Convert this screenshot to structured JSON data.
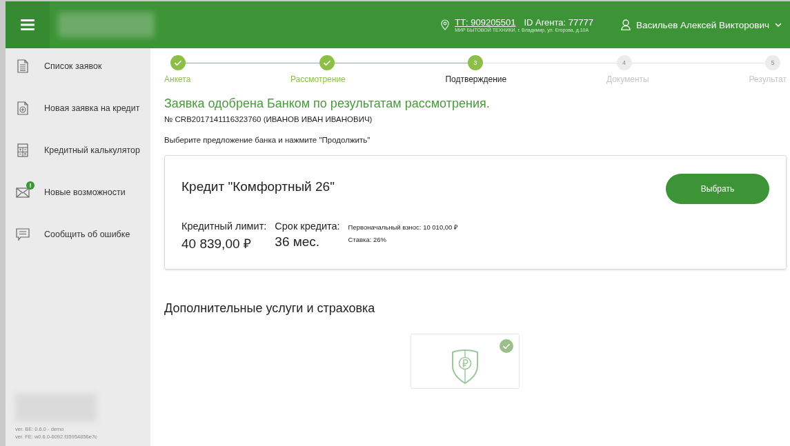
{
  "header": {
    "location_link": "ТТ: 909205501",
    "agent_id": "ID Агента: 77777",
    "address": "МИР БЫТОВОЙ ТЕХНИКИ, г. Владимир, ул. Егорова, д.10А",
    "user_name": "Васильев Алексей Викторович"
  },
  "sidebar": {
    "items": [
      {
        "kind": "list",
        "label": "Список заявок"
      },
      {
        "kind": "new",
        "label": "Новая заявка на кредит"
      },
      {
        "kind": "calculator",
        "label": "Кредитный калькулятор"
      },
      {
        "kind": "mail",
        "label": "Новые возможности",
        "badge": "!"
      },
      {
        "kind": "feedback",
        "label": "Сообщить об ошибке"
      }
    ],
    "versions": [
      "ver. BE: 0.6.0 - demo",
      "ver. FE: w0.6.0-6092.f35954856e7c"
    ]
  },
  "steps": [
    {
      "label": "Анкета",
      "done": true,
      "selected": false
    },
    {
      "label": "Рассмотрение",
      "done": true,
      "selected": false
    },
    {
      "label": "Подтверждение",
      "done": false,
      "selected": true,
      "number": "3"
    },
    {
      "label": "Документы",
      "done": false,
      "selected": false,
      "number": "4"
    },
    {
      "label": "Результат",
      "done": false,
      "selected": false,
      "number": "5"
    }
  ],
  "approval_title": "Заявка одобрена Банком по результатам рассмотрения.",
  "application_number": "№ CRB2017141116323760 (ИВАНОВ ИВАН ИВАНОВИЧ)",
  "instruction": "Выберите предложение банка и нажмите \"Продолжить\"",
  "offer": {
    "title": "Кредит \"Комфортный 26\"",
    "button": "Выбрать",
    "limit_label": "Кредитный лимит:",
    "limit_value": "40 839,00 ₽",
    "term_label": "Срок кредита:",
    "term_value": "36 мес.",
    "details": [
      "Первоначальный взнос: 10 010,00 ₽",
      "Ставка: 26%"
    ]
  },
  "services": {
    "title": "Дополнительные услуги и страховка",
    "items": [
      {
        "kind": "insurance",
        "checked": true
      }
    ]
  }
}
